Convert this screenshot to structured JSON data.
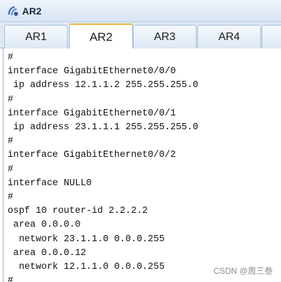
{
  "window": {
    "title": "AR2"
  },
  "tabs": [
    {
      "label": "AR1",
      "active": false
    },
    {
      "label": "AR2",
      "active": true
    },
    {
      "label": "AR3",
      "active": false
    },
    {
      "label": "AR4",
      "active": false
    },
    {
      "label": "",
      "active": false
    }
  ],
  "console": {
    "lines": [
      "#",
      "interface GigabitEthernet0/0/0",
      " ip address 12.1.1.2 255.255.255.0",
      "#",
      "interface GigabitEthernet0/0/1",
      " ip address 23.1.1.1 255.255.255.0",
      "#",
      "interface GigabitEthernet0/0/2",
      "#",
      "interface NULL0",
      "#",
      "ospf 10 router-id 2.2.2.2",
      " area 0.0.0.0",
      "  network 23.1.1.0 0.0.0.255",
      " area 0.0.0.12",
      "  network 12.1.1.0 0.0.0.255",
      "#"
    ]
  },
  "watermark": "CSDN @周三叁",
  "colors": {
    "active_tab_accent": "#f0b43c",
    "titlebar": "#d7e4f3"
  }
}
